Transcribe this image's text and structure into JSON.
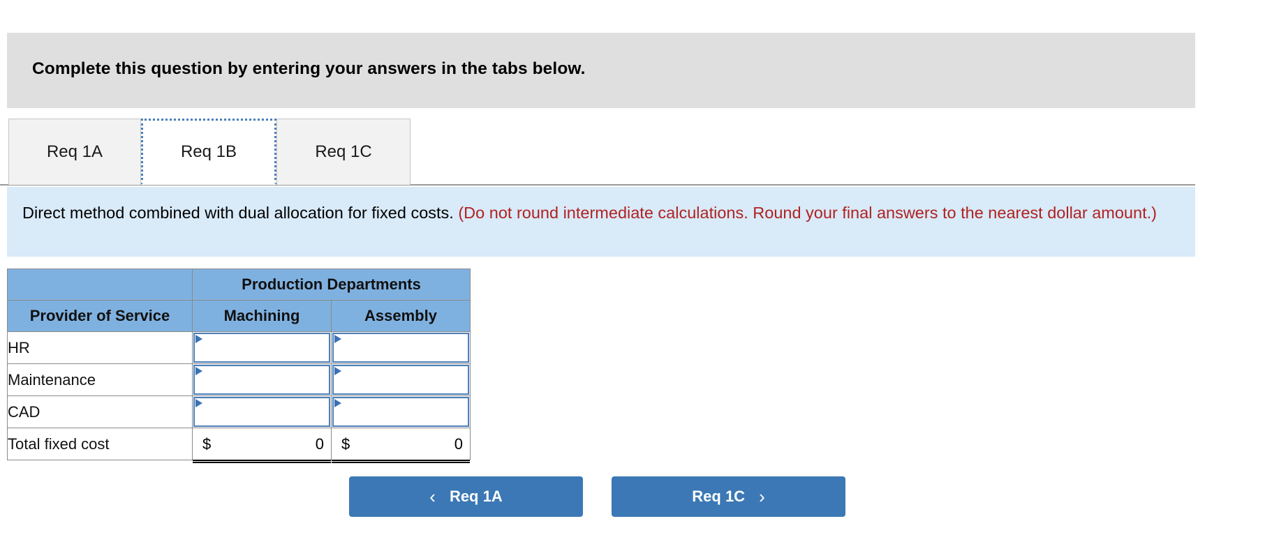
{
  "banner": {
    "text": "Complete this question by entering your answers in the tabs below."
  },
  "tabs": [
    {
      "id": "req-1a",
      "label": "Req 1A",
      "active": false
    },
    {
      "id": "req-1b",
      "label": "Req 1B",
      "active": true
    },
    {
      "id": "req-1c",
      "label": "Req 1C",
      "active": false
    }
  ],
  "info": {
    "main": "Direct method combined with dual allocation for fixed costs.",
    "hint": "(Do not round intermediate calculations. Round your final answers to the nearest dollar amount.)"
  },
  "table": {
    "group_header": "Production Departments",
    "col_provider": "Provider of Service",
    "columns": [
      "Machining",
      "Assembly"
    ],
    "rows": [
      {
        "label": "HR",
        "values": [
          "",
          ""
        ]
      },
      {
        "label": "Maintenance",
        "values": [
          "",
          ""
        ]
      },
      {
        "label": "CAD",
        "values": [
          "",
          ""
        ]
      }
    ],
    "total": {
      "label": "Total fixed cost",
      "currency": "$",
      "values": [
        "0",
        "0"
      ]
    }
  },
  "nav": {
    "prev_label": "Req 1A",
    "next_label": "Req 1C",
    "prev_icon": "chevron-left-icon",
    "next_icon": "chevron-right-icon",
    "prev_glyph": "‹",
    "next_glyph": "›"
  },
  "colors": {
    "banner_gray": "#dfdfdf",
    "info_blue": "#d9eaf8",
    "hint_red": "#b02222",
    "table_header_blue": "#7fb1e0",
    "input_border_blue": "#4a7ebb",
    "button_blue": "#3b78b5"
  }
}
